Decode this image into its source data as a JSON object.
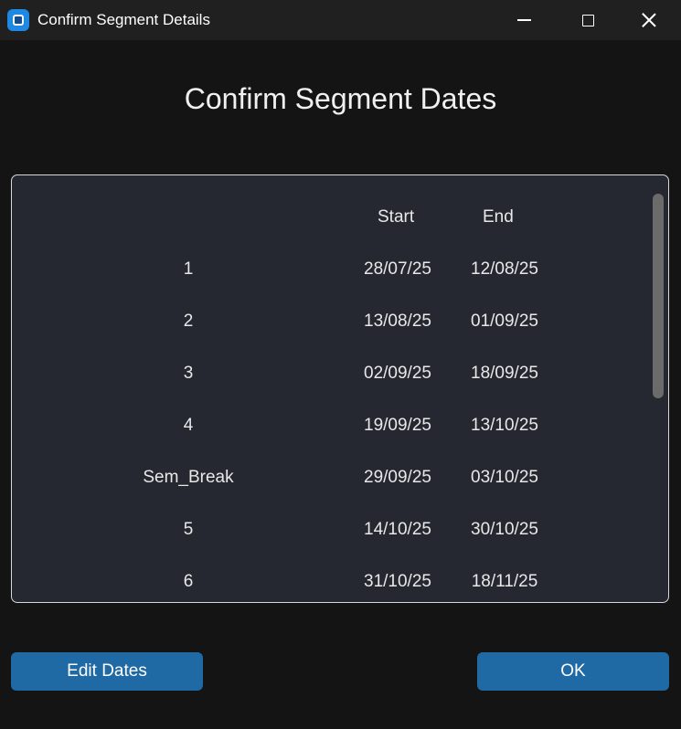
{
  "window": {
    "title": "Confirm Segment Details"
  },
  "heading": "Confirm Segment Dates",
  "table": {
    "headers": {
      "segment": "",
      "start": "Start",
      "end": "End"
    },
    "rows": [
      {
        "segment": "1",
        "start": "28/07/25",
        "end": "12/08/25"
      },
      {
        "segment": "2",
        "start": "13/08/25",
        "end": "01/09/25"
      },
      {
        "segment": "3",
        "start": "02/09/25",
        "end": "18/09/25"
      },
      {
        "segment": "4",
        "start": "19/09/25",
        "end": "13/10/25"
      },
      {
        "segment": "Sem_Break",
        "start": "29/09/25",
        "end": "03/10/25"
      },
      {
        "segment": "5",
        "start": "14/10/25",
        "end": "30/10/25"
      },
      {
        "segment": "6",
        "start": "31/10/25",
        "end": "18/11/25"
      }
    ]
  },
  "buttons": {
    "edit_label": "Edit Dates",
    "ok_label": "OK"
  },
  "colors": {
    "accent": "#1f6aa5",
    "panel": "#252830",
    "background": "#141414"
  }
}
